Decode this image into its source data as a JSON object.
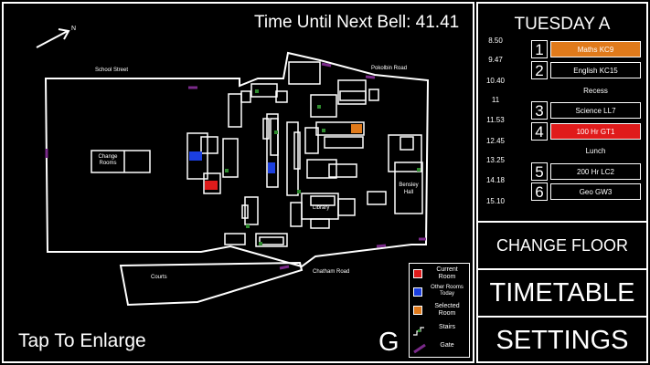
{
  "header": {
    "bell_label": "Time Until Next Bell: 41.41"
  },
  "map": {
    "compass_label": "N",
    "labels": {
      "school_street": "School Street",
      "pokolbin_road": "Pokolbin Road",
      "chatham_road": "Chatham Road",
      "courts": "Courts",
      "change_rooms": "Change Rooms",
      "library": "Library",
      "bensley_hall": "Bensley Hall"
    },
    "enlarge_label": "Tap To Enlarge",
    "floor_letter": "G"
  },
  "legend": {
    "current_room": "Current Room",
    "other_rooms": "Other Rooms Today",
    "selected_room": "Selected Room",
    "stairs": "Stairs",
    "gate": "Gate"
  },
  "colors": {
    "current": "#e01b1b",
    "other": "#1b3fe0",
    "selected": "#e07a1b",
    "stairs": "#2e8b2e",
    "gate": "#7a2a8a"
  },
  "timetable": {
    "day": "TUESDAY A",
    "times": [
      "8.50",
      "9.47",
      "10.40",
      "11",
      "11.53",
      "12.45",
      "13.25",
      "14.18",
      "15.10"
    ],
    "periods": [
      {
        "num": "1",
        "label": "Maths KC9"
      },
      {
        "num": "2",
        "label": "English KC15"
      },
      {
        "num": "",
        "label": "Recess"
      },
      {
        "num": "3",
        "label": "Science LL7"
      },
      {
        "num": "4",
        "label": "100 Hr GT1"
      },
      {
        "num": "",
        "label": "Lunch"
      },
      {
        "num": "5",
        "label": "200 Hr LC2"
      },
      {
        "num": "6",
        "label": "Geo GW3"
      }
    ]
  },
  "menu": {
    "change_floor": "CHANGE FLOOR",
    "timetable": "TIMETABLE",
    "settings": "SETTINGS"
  }
}
